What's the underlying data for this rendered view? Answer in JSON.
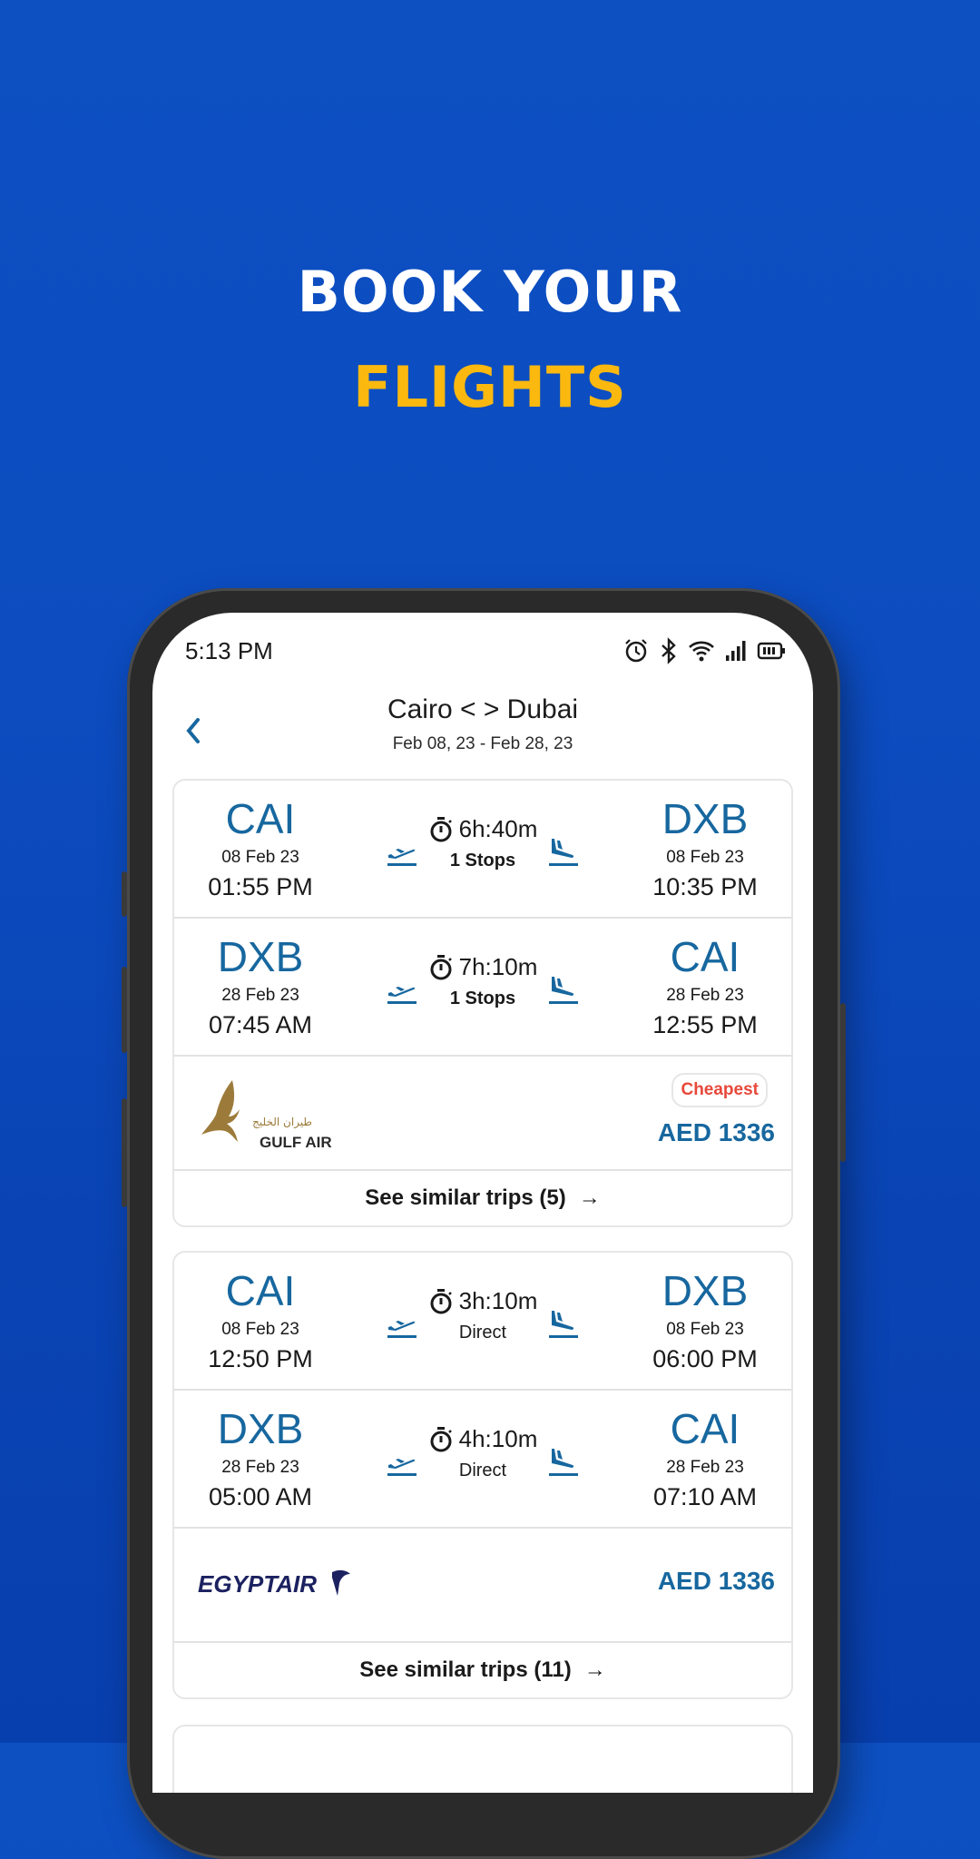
{
  "headline": {
    "line1": "BOOK YOUR",
    "line2": "FLIGHTS"
  },
  "colors": {
    "background": "#0c4cc0",
    "accent_yellow": "#fbb80f",
    "primary_blue": "#17679f",
    "cheapest_red": "#e8483a"
  },
  "status_bar": {
    "time": "5:13 PM",
    "icons": [
      "alarm-icon",
      "bluetooth-icon",
      "wifi-icon",
      "signal-icon",
      "battery-icon"
    ]
  },
  "app_bar": {
    "back_icon": "chevron-left-icon",
    "title": "Cairo < > Dubai",
    "subtitle": "Feb 08, 23 - Feb 28, 23"
  },
  "results": [
    {
      "legs": [
        {
          "from_code": "CAI",
          "from_date": "08 Feb 23",
          "from_time": "01:55 PM",
          "duration": "6h:40m",
          "stops": "1 Stops",
          "to_code": "DXB",
          "to_date": "08 Feb 23",
          "to_time": "10:35 PM"
        },
        {
          "from_code": "DXB",
          "from_date": "28 Feb 23",
          "from_time": "07:45 AM",
          "duration": "7h:10m",
          "stops": "1 Stops",
          "to_code": "CAI",
          "to_date": "28 Feb 23",
          "to_time": "12:55 PM"
        }
      ],
      "airline": {
        "name": "GULF AIR",
        "name_arabic": "طيران الخليج"
      },
      "badge": "Cheapest",
      "price": "AED 1336",
      "similar_label": "See similar trips (5)",
      "arrow": "→"
    },
    {
      "legs": [
        {
          "from_code": "CAI",
          "from_date": "08 Feb 23",
          "from_time": "12:50 PM",
          "duration": "3h:10m",
          "stops": "Direct",
          "to_code": "DXB",
          "to_date": "08 Feb 23",
          "to_time": "06:00 PM"
        },
        {
          "from_code": "DXB",
          "from_date": "28 Feb 23",
          "from_time": "05:00 AM",
          "duration": "4h:10m",
          "stops": "Direct",
          "to_code": "CAI",
          "to_date": "28 Feb 23",
          "to_time": "07:10 AM"
        }
      ],
      "airline": {
        "name": "EGYPTAIR"
      },
      "price": "AED 1336",
      "similar_label": "See similar trips (11)",
      "arrow": "→"
    }
  ]
}
